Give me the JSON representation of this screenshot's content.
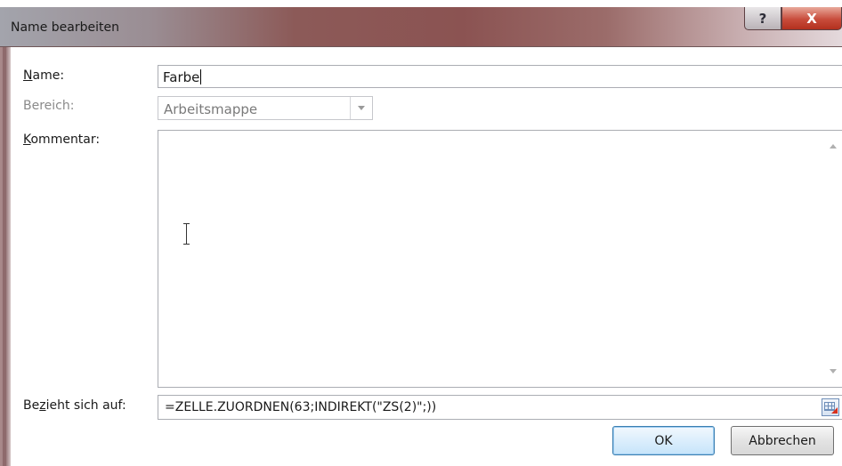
{
  "window": {
    "title": "Name bearbeiten",
    "help_label": "?",
    "close_label": "X"
  },
  "form": {
    "name_label_hotkey": "N",
    "name_label_rest": "ame:",
    "name_value": "Farbe",
    "scope_label": "Bereich:",
    "scope_value": "Arbeitsmappe",
    "comment_label_hotkey": "K",
    "comment_label_rest": "ommentar:",
    "comment_value": "",
    "refers_label_pre": "Be",
    "refers_label_hotkey": "z",
    "refers_label_rest": "ieht sich auf:",
    "refers_value": "=ZELLE.ZUORDNEN(63;INDIREKT(\"ZS(2)\";))"
  },
  "buttons": {
    "ok_label": "OK",
    "cancel_label": "Abbrechen"
  },
  "colors": {
    "accent_button_border": "#3c7fb1",
    "close_button": "#c84c3b",
    "disabled_text": "#8a8a8a"
  }
}
